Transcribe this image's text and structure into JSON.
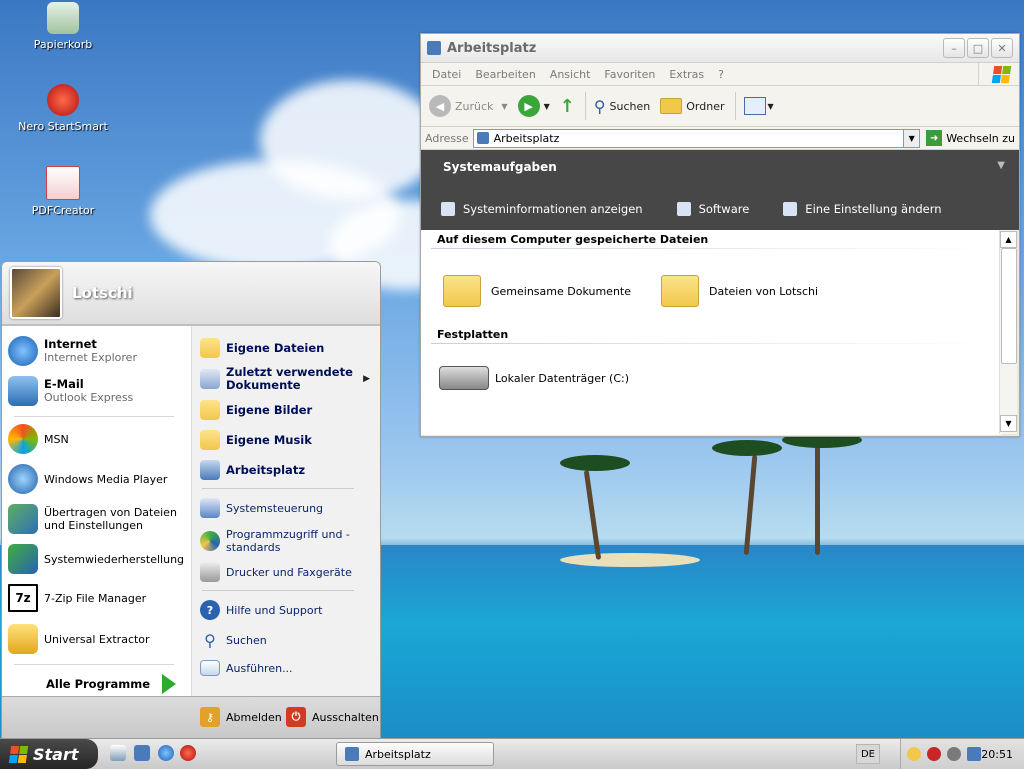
{
  "desktop": {
    "icons": [
      {
        "label": "Papierkorb",
        "icon": "recycle-bin-icon"
      },
      {
        "label": "Nero StartSmart",
        "icon": "nero-icon"
      },
      {
        "label": "PDFCreator",
        "icon": "pdf-icon"
      }
    ]
  },
  "explorer": {
    "title": "Arbeitsplatz",
    "menu": [
      "Datei",
      "Bearbeiten",
      "Ansicht",
      "Favoriten",
      "Extras",
      "?"
    ],
    "toolbar": {
      "back": "Zurück",
      "search": "Suchen",
      "folders": "Ordner"
    },
    "address": {
      "label": "Adresse",
      "value": "Arbeitsplatz",
      "go": "Wechseln zu"
    },
    "tasks": {
      "heading": "Systemaufgaben",
      "items": [
        "Systeminformationen anzeigen",
        "Software",
        "Eine Einstellung ändern"
      ]
    },
    "sections": {
      "stored_files": "Auf diesem Computer gespeicherte Dateien",
      "folders": [
        "Gemeinsame Dokumente",
        "Dateien von Lotschi"
      ],
      "hard_disks": "Festplatten",
      "drives": [
        "Lokaler Datenträger (C:)"
      ]
    }
  },
  "startmenu": {
    "user": "Lotschi",
    "pinned": [
      {
        "title": "Internet",
        "sub": "Internet Explorer"
      },
      {
        "title": "E-Mail",
        "sub": "Outlook Express"
      }
    ],
    "recent": [
      "MSN",
      "Windows Media Player",
      "Übertragen von Dateien und Einstellungen",
      "Systemwiederherstellung",
      "7-Zip File Manager",
      "Universal Extractor"
    ],
    "all_programs": "Alle Programme",
    "places": [
      "Eigene Dateien",
      "Zuletzt verwendete Dokumente",
      "Eigene Bilder",
      "Eigene Musik",
      "Arbeitsplatz"
    ],
    "settings": [
      "Systemsteuerung",
      "Programmzugriff und -standards",
      "Drucker und Faxgeräte"
    ],
    "help": [
      "Hilfe und Support",
      "Suchen",
      "Ausführen..."
    ],
    "logoff": "Abmelden",
    "shutdown": "Ausschalten"
  },
  "taskbar": {
    "start": "Start",
    "task": "Arbeitsplatz",
    "language": "DE",
    "clock": "20:51"
  },
  "colors": {
    "accent_green": "#2eab2e",
    "task_pane": "#474747"
  }
}
